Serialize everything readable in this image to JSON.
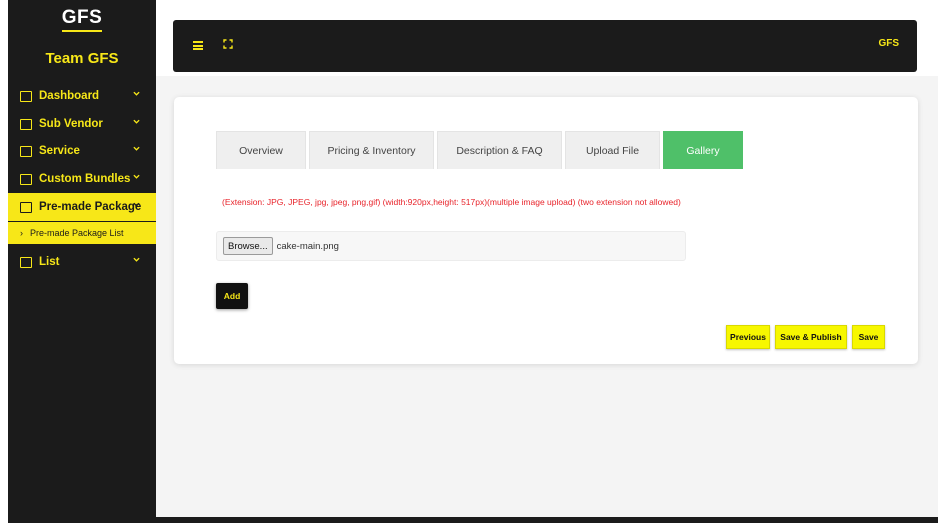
{
  "brand": {
    "logo_text": "GFS",
    "team_name": "Team GFS",
    "top_logo": "GFS",
    "accent_color": "#f7e718",
    "dark_color": "#1b1b1b",
    "active_tab_color": "#4fc069"
  },
  "sidebar": {
    "items": [
      {
        "label": "Dashboard",
        "icon": "grid-icon"
      },
      {
        "label": "Sub Vendor",
        "icon": "grid-icon"
      },
      {
        "label": "Service",
        "icon": "service-icon"
      },
      {
        "label": "Custom Bundles",
        "icon": "bundle-icon"
      },
      {
        "label": "Pre-made Package",
        "icon": "package-icon"
      },
      {
        "label": "List",
        "icon": "list-icon"
      }
    ],
    "submenu": {
      "label": "Pre-made Package List"
    }
  },
  "tabs": [
    {
      "label": "Overview"
    },
    {
      "label": "Pricing & Inventory"
    },
    {
      "label": "Description & FAQ"
    },
    {
      "label": "Upload File"
    },
    {
      "label": "Gallery"
    }
  ],
  "gallery": {
    "notice": "(Extension: JPG, JPEG, jpg, jpeg, png,gif) (width:920px,height: 517px)(multiple image upload) (two extension not allowed)",
    "browse_label": "Browse...",
    "file_name": "cake-main.png",
    "add_label": "Add"
  },
  "actions": {
    "previous": "Previous",
    "save_publish": "Save & Publish",
    "save": "Save"
  }
}
